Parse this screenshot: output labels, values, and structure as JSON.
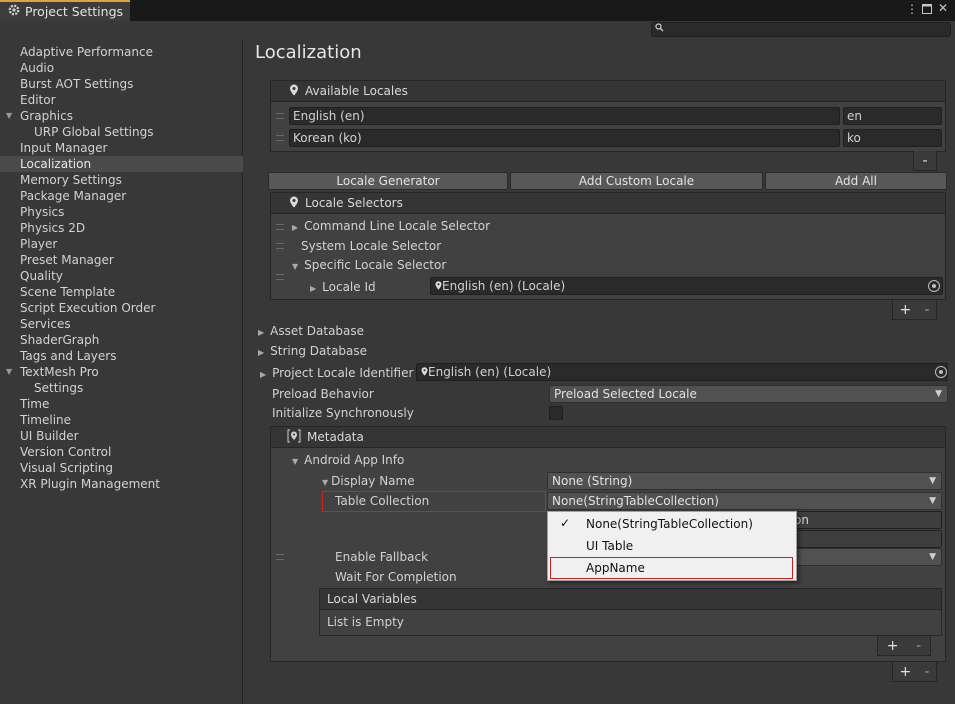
{
  "window": {
    "title": "Project Settings",
    "menu_icon": "kebab-icon",
    "maximize_icon": "maximize-icon",
    "close_icon": "close-icon"
  },
  "search": {
    "icon": "search-icon",
    "placeholder": ""
  },
  "sidebar": {
    "items": [
      {
        "label": "Adaptive Performance"
      },
      {
        "label": "Audio"
      },
      {
        "label": "Burst AOT Settings"
      },
      {
        "label": "Editor"
      },
      {
        "label": "Graphics",
        "expanded": true
      },
      {
        "label": "URP Global Settings",
        "child": true
      },
      {
        "label": "Input Manager"
      },
      {
        "label": "Localization",
        "selected": true
      },
      {
        "label": "Memory Settings"
      },
      {
        "label": "Package Manager"
      },
      {
        "label": "Physics"
      },
      {
        "label": "Physics 2D"
      },
      {
        "label": "Player"
      },
      {
        "label": "Preset Manager"
      },
      {
        "label": "Quality"
      },
      {
        "label": "Scene Template"
      },
      {
        "label": "Script Execution Order"
      },
      {
        "label": "Services"
      },
      {
        "label": "ShaderGraph"
      },
      {
        "label": "Tags and Layers"
      },
      {
        "label": "TextMesh Pro",
        "expanded": true
      },
      {
        "label": "Settings",
        "child": true
      },
      {
        "label": "Time"
      },
      {
        "label": "Timeline"
      },
      {
        "label": "UI Builder"
      },
      {
        "label": "Version Control"
      },
      {
        "label": "Visual Scripting"
      },
      {
        "label": "XR Plugin Management"
      }
    ]
  },
  "main": {
    "title": "Localization",
    "available_locales": {
      "header": "Available Locales",
      "rows": [
        {
          "name": "English (en)",
          "code": "en"
        },
        {
          "name": "Korean (ko)",
          "code": "ko"
        }
      ],
      "remove": "-"
    },
    "buttons": {
      "generator": "Locale Generator",
      "add_custom": "Add Custom Locale",
      "add_all": "Add All"
    },
    "locale_selectors": {
      "header": "Locale Selectors",
      "items": [
        "Command Line Locale Selector",
        "System Locale Selector",
        "Specific Locale Selector"
      ],
      "locale_id_label": "Locale Id",
      "locale_id_value": "English (en) (Locale)",
      "add": "+",
      "remove": "-"
    },
    "asset_database": "Asset Database",
    "string_database": "String Database",
    "project_locale_identifier": {
      "label": "Project Locale Identifier",
      "value": "English (en) (Locale)"
    },
    "preload_behavior": {
      "label": "Preload Behavior",
      "value": "Preload Selected Locale"
    },
    "initialize_sync": {
      "label": "Initialize Synchronously"
    },
    "metadata": {
      "header": "Metadata",
      "android_app_info": "Android App Info",
      "display_name": {
        "label": "Display Name",
        "value": "None (String)"
      },
      "table_collection": {
        "label": "Table Collection",
        "value": "None(StringTableCollection)"
      },
      "hidden_field_tail": "on",
      "enable_fallback": "Enable Fallback",
      "wait_for_completion": "Wait For Completion",
      "local_variables": {
        "header": "Local Variables",
        "empty": "List is Empty",
        "add": "+",
        "remove": "-"
      },
      "add": "+",
      "remove": "-"
    },
    "popup": {
      "check": "✓",
      "options": [
        "None(StringTableCollection)",
        "UI Table",
        "AppName"
      ],
      "selected_index": 0,
      "highlighted": "AppName"
    }
  },
  "colors": {
    "highlight_border": "#d02020",
    "selected_row": "#4a4a4a",
    "tab_accent": "#e0a040"
  }
}
